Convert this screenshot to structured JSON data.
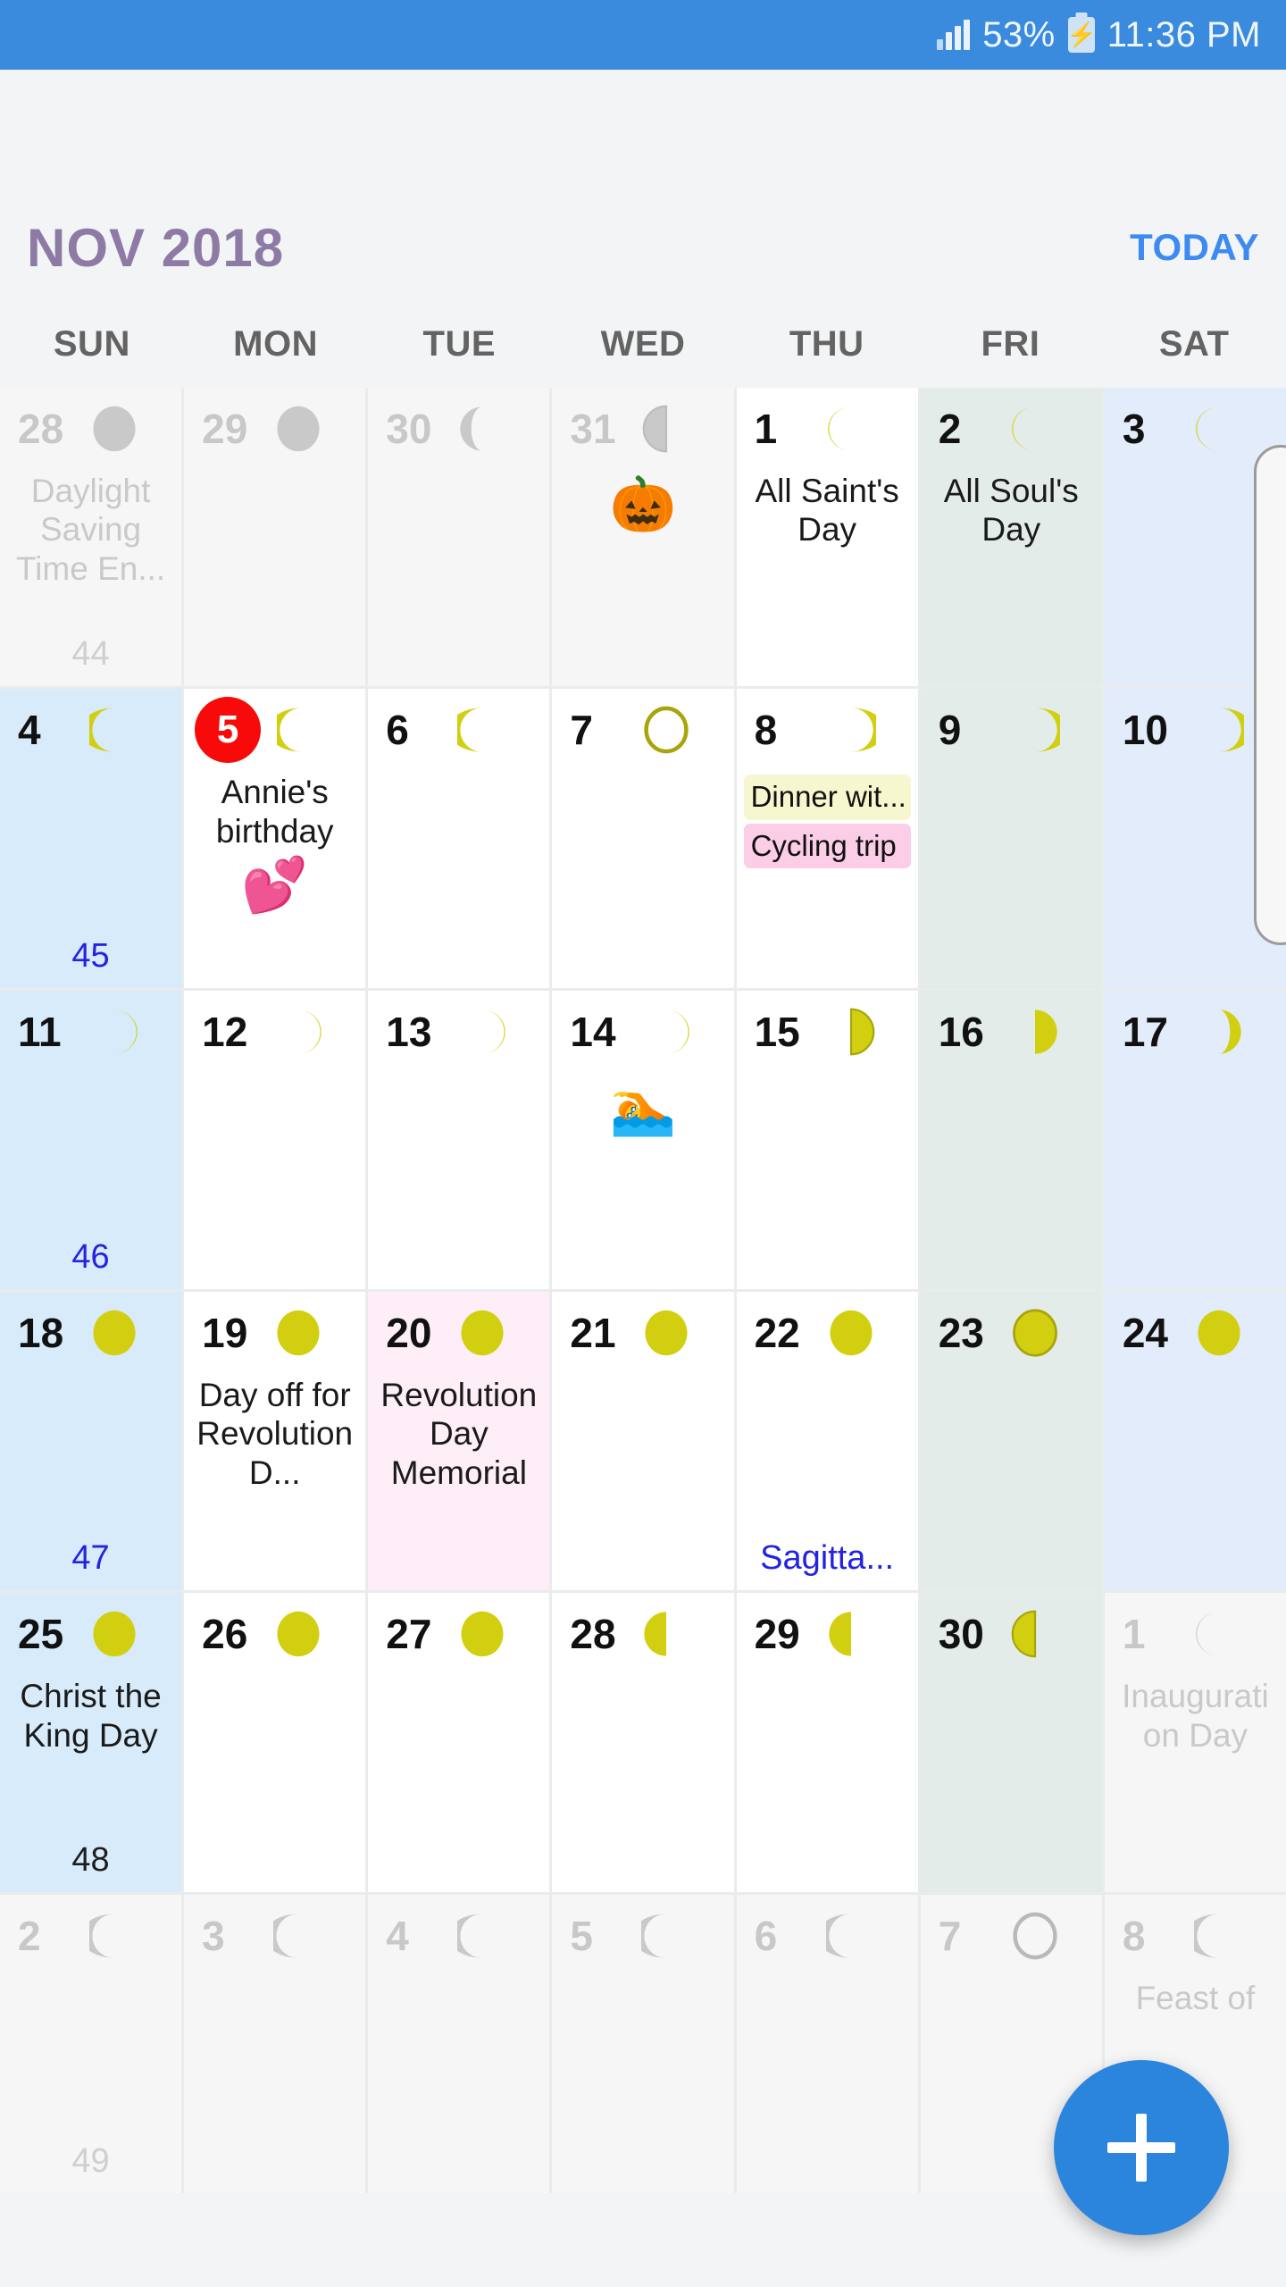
{
  "statusbar": {
    "battery_percent": "53%",
    "time": "11:36 PM",
    "signal_icon": "signal-bars-icon",
    "battery_icon": "battery-charging-icon"
  },
  "header": {
    "month_title": "NOV 2018",
    "today_label": "TODAY",
    "title_color": "#8d7ba5",
    "today_color": "#3d8bf2"
  },
  "weekdays": [
    "SUN",
    "MON",
    "TUE",
    "WED",
    "THU",
    "FRI",
    "SAT"
  ],
  "fab": {
    "label": "+",
    "icon": "plus-icon",
    "color": "#2c85dd"
  },
  "colors": {
    "accent_blue": "#3d8bf2",
    "today_red": "#f80a0a",
    "moon_yellow": "#d2cf10",
    "sunday_bg": "#d7ebfb",
    "friday_bg": "#e4ecea",
    "saturday_bg": "#e2ecfa",
    "holiday_bg": "#fdeef8",
    "outside_bg": "#f6f6f6",
    "weeknum_blue": "#2323e0"
  },
  "weeks": [
    {
      "week_number": "44",
      "week_number_style": "muted",
      "days": [
        {
          "num": "28",
          "outside": true,
          "moon": "full-grey",
          "events": [
            "Daylight Saving Time En..."
          ]
        },
        {
          "num": "29",
          "outside": true,
          "moon": "full-grey"
        },
        {
          "num": "30",
          "outside": true,
          "moon": "waning-gibbous-grey"
        },
        {
          "num": "31",
          "outside": true,
          "moon": "last-quarter-grey",
          "emoji": "🎃"
        },
        {
          "num": "1",
          "moon": "waning-crescent",
          "events": [
            "All Saint's Day"
          ]
        },
        {
          "num": "2",
          "moon": "waning-crescent",
          "events": [
            "All Soul's Day"
          ]
        },
        {
          "num": "3",
          "moon": "waning-crescent"
        }
      ]
    },
    {
      "week_number": "45",
      "week_number_style": "blue",
      "days": [
        {
          "num": "4",
          "moon": "waning-crescent-thin"
        },
        {
          "num": "5",
          "today": true,
          "moon": "waning-crescent-thin",
          "events": [
            "Annie's birthday"
          ],
          "emoji": "💕"
        },
        {
          "num": "6",
          "moon": "waning-crescent-thin"
        },
        {
          "num": "7",
          "moon": "new-moon"
        },
        {
          "num": "8",
          "moon": "waxing-crescent-thin",
          "chips": [
            {
              "text": "Dinner wit...",
              "color": "yellow"
            },
            {
              "text": "Cycling trip",
              "color": "pink"
            }
          ]
        },
        {
          "num": "9",
          "moon": "waxing-crescent-thin"
        },
        {
          "num": "10",
          "moon": "waxing-crescent-thin"
        }
      ]
    },
    {
      "week_number": "46",
      "week_number_style": "blue",
      "days": [
        {
          "num": "11",
          "moon": "waxing-crescent"
        },
        {
          "num": "12",
          "moon": "waxing-crescent"
        },
        {
          "num": "13",
          "moon": "waxing-crescent"
        },
        {
          "num": "14",
          "moon": "waxing-crescent",
          "emoji": "🏊"
        },
        {
          "num": "15",
          "moon": "first-quarter"
        },
        {
          "num": "16",
          "moon": "waxing-gibbous-half"
        },
        {
          "num": "17",
          "moon": "waxing-gibbous"
        }
      ]
    },
    {
      "week_number": "47",
      "week_number_style": "blue",
      "days": [
        {
          "num": "18",
          "moon": "full"
        },
        {
          "num": "19",
          "moon": "full",
          "events": [
            "Day off for Revolution D..."
          ]
        },
        {
          "num": "20",
          "moon": "full",
          "holiday": true,
          "events": [
            "Revolution Day Memorial"
          ]
        },
        {
          "num": "21",
          "moon": "full"
        },
        {
          "num": "22",
          "moon": "full",
          "zodiac": "Sagitta..."
        },
        {
          "num": "23",
          "moon": "full-outline"
        },
        {
          "num": "24",
          "moon": "full"
        }
      ]
    },
    {
      "week_number": "48",
      "week_number_style": "dark",
      "days": [
        {
          "num": "25",
          "moon": "full",
          "events": [
            "Christ the King Day"
          ]
        },
        {
          "num": "26",
          "moon": "full"
        },
        {
          "num": "27",
          "moon": "full"
        },
        {
          "num": "28",
          "moon": "waning-gibbous-half"
        },
        {
          "num": "29",
          "moon": "waning-gibbous-half"
        },
        {
          "num": "30",
          "moon": "last-quarter"
        },
        {
          "num": "1",
          "outside": true,
          "moon": "waning-crescent-grey",
          "events": [
            "Inauguration Day"
          ]
        }
      ]
    },
    {
      "week_number": "49",
      "week_number_style": "muted",
      "days": [
        {
          "num": "2",
          "outside": true,
          "moon": "waning-crescent-grey-thin"
        },
        {
          "num": "3",
          "outside": true,
          "moon": "waning-crescent-grey-thin"
        },
        {
          "num": "4",
          "outside": true,
          "moon": "waning-crescent-grey-thin"
        },
        {
          "num": "5",
          "outside": true,
          "moon": "waning-crescent-grey-thin"
        },
        {
          "num": "6",
          "outside": true,
          "moon": "waning-crescent-grey-thin"
        },
        {
          "num": "7",
          "outside": true,
          "moon": "new-moon-grey"
        },
        {
          "num": "8",
          "outside": true,
          "moon": "waning-crescent-grey-thin",
          "events": [
            "Feast of"
          ]
        }
      ]
    }
  ]
}
